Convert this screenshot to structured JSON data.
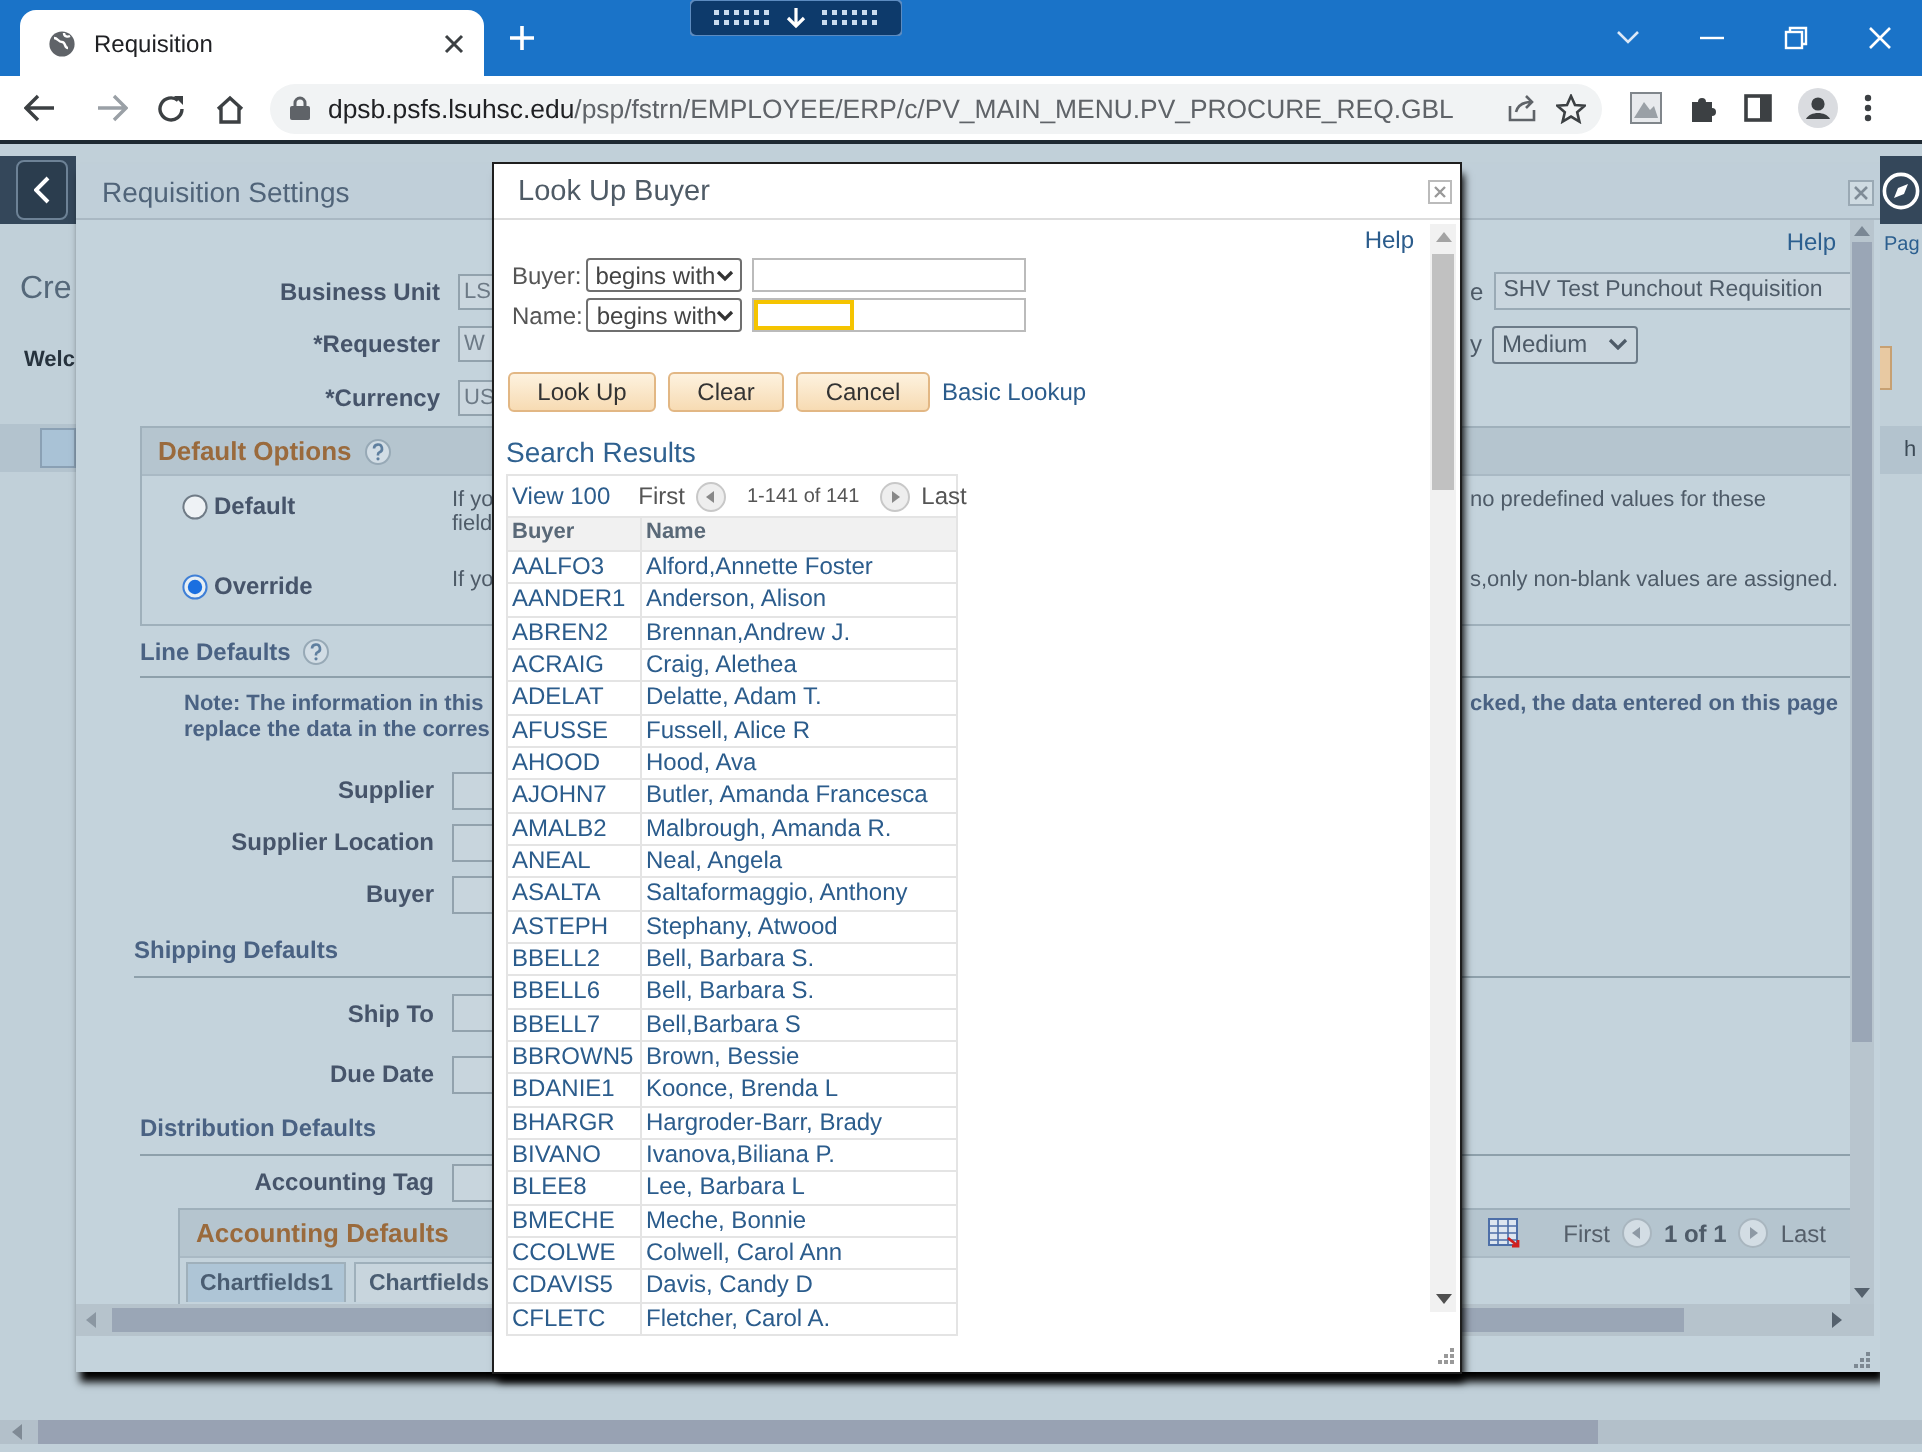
{
  "browser": {
    "tab_title": "Requisition",
    "url_host": "dpsb.psfs.lsuhsc.edu",
    "url_path": "/psp/fstrn/EMPLOYEE/ERP/c/PV_MAIN_MENU.PV_PROCURE_REQ.GBL"
  },
  "background_page": {
    "left_fragments": [
      {
        "kind": "heading",
        "text": "Cre"
      },
      {
        "kind": "bold",
        "text": "Welc"
      }
    ],
    "right_fragments": [
      {
        "kind": "link",
        "text": "Pag"
      },
      {
        "kind": "band",
        "text": "h"
      }
    ]
  },
  "settings_modal": {
    "title": "Requisition Settings",
    "help": "Help",
    "header_fields": [
      {
        "label": "Business Unit",
        "value": "LS"
      },
      {
        "label": "*Requester",
        "value": "W"
      },
      {
        "label": "*Currency",
        "value": "US"
      }
    ],
    "right_fields": [
      {
        "kind": "text",
        "label": "e",
        "value": "SHV Test Punchout Requisition"
      },
      {
        "kind": "select",
        "label": "y",
        "value": "Medium"
      }
    ],
    "default_options": {
      "title": "Default Options",
      "options": [
        {
          "label": "Default",
          "selected": false,
          "text_left": [
            "If yo",
            "field"
          ],
          "text_right": "no predefined values for these"
        },
        {
          "label": "Override",
          "selected": true,
          "text_left": [
            "If yo"
          ],
          "text_right": "s,only non-blank values are assigned."
        }
      ]
    },
    "line_defaults": {
      "title": "Line Defaults",
      "note_left": [
        "Note: The information in this",
        "replace the data in the corres"
      ],
      "note_right": "cked, the data entered on this page",
      "fields": [
        "Supplier",
        "Supplier Location",
        "Buyer"
      ]
    },
    "shipping_defaults": {
      "title": "Shipping Defaults",
      "fields": [
        "Ship To",
        "Due Date"
      ]
    },
    "distribution_defaults": {
      "title": "Distribution Defaults",
      "fields": [
        "Accounting Tag"
      ]
    },
    "accounting_defaults": {
      "title": "Accounting Defaults",
      "tabs": [
        {
          "label": "Chartfields1",
          "selected": true
        },
        {
          "label": "Chartfields",
          "selected": false
        }
      ],
      "pager": {
        "first": "First",
        "count": "1 of 1",
        "last": "Last"
      }
    }
  },
  "lookup_modal": {
    "title": "Look Up Buyer",
    "help": "Help",
    "criteria": [
      {
        "label": "Buyer:",
        "operator": "begins with",
        "focused": false
      },
      {
        "label": "Name:",
        "operator": "begins with",
        "focused": true
      }
    ],
    "buttons": [
      "Look Up",
      "Clear",
      "Cancel"
    ],
    "link": "Basic Lookup",
    "results_title": "Search Results",
    "grid": {
      "view": "View 100",
      "first": "First",
      "range": "1-141 of 141",
      "last": "Last",
      "columns": [
        "Buyer",
        "Name"
      ],
      "rows": [
        [
          "AALFO3",
          "Alford,Annette Foster"
        ],
        [
          "AANDER1",
          "Anderson, Alison"
        ],
        [
          "ABREN2",
          "Brennan,Andrew J."
        ],
        [
          "ACRAIG",
          "Craig, Alethea"
        ],
        [
          "ADELAT",
          "Delatte, Adam T."
        ],
        [
          "AFUSSE",
          "Fussell, Alice R"
        ],
        [
          "AHOOD",
          "Hood, Ava"
        ],
        [
          "AJOHN7",
          "Butler, Amanda Francesca"
        ],
        [
          "AMALB2",
          "Malbrough, Amanda R."
        ],
        [
          "ANEAL",
          "Neal, Angela"
        ],
        [
          "ASALTA",
          "Saltaformaggio, Anthony"
        ],
        [
          "ASTEPH",
          "Stephany, Atwood"
        ],
        [
          "BBELL2",
          "Bell, Barbara S."
        ],
        [
          "BBELL6",
          "Bell, Barbara S."
        ],
        [
          "BBELL7",
          "Bell,Barbara S"
        ],
        [
          "BBROWN5",
          "Brown, Bessie"
        ],
        [
          "BDANIE1",
          "Koonce, Brenda L"
        ],
        [
          "BHARGR",
          "Hargroder-Barr, Brady"
        ],
        [
          "BIVANO",
          "Ivanova,Biliana P."
        ],
        [
          "BLEE8",
          "Lee, Barbara L"
        ],
        [
          "BMECHE",
          "Meche, Bonnie"
        ],
        [
          "CCOLWE",
          "Colwell, Carol Ann"
        ],
        [
          "CDAVIS5",
          "Davis, Candy D"
        ],
        [
          "CFLETC",
          "Fletcher, Carol A."
        ]
      ]
    }
  }
}
